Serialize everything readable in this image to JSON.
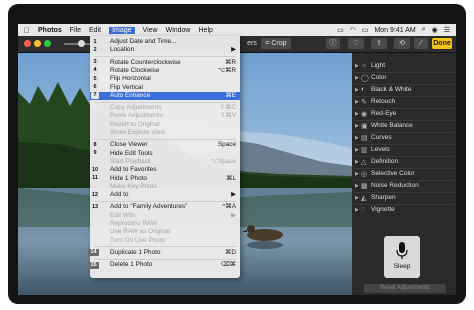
{
  "menubar": {
    "apple": "",
    "app": "Photos",
    "items": [
      "File",
      "Edit",
      "Image",
      "View",
      "Window",
      "Help"
    ],
    "clock": "Mon 9:41 AM"
  },
  "toolbar": {
    "filters_label": "ers",
    "crop_label": "Crop",
    "done_label": "Done"
  },
  "image_menu": [
    {
      "badge": "1",
      "label": "Adjust Date and Time...",
      "shortcut": "",
      "enabled": true
    },
    {
      "badge": "2",
      "label": "Location",
      "shortcut": "▶",
      "enabled": true
    },
    {
      "badge": "3",
      "label": "Rotate Counterclockwise",
      "shortcut": "⌘R",
      "enabled": true
    },
    {
      "badge": "4",
      "label": "Rotate Clockwise",
      "shortcut": "⌥⌘R",
      "enabled": true
    },
    {
      "badge": "5",
      "label": "Flip Horizontal",
      "shortcut": "",
      "enabled": true
    },
    {
      "badge": "6",
      "label": "Flip Vertical",
      "shortcut": "",
      "enabled": true
    },
    {
      "badge": "7",
      "label": "Auto Enhance",
      "shortcut": "⌘E",
      "enabled": true
    },
    {
      "badge": "",
      "label": "Copy Adjustments",
      "shortcut": "⇧⌘C",
      "enabled": false
    },
    {
      "badge": "",
      "label": "Paste Adjustments",
      "shortcut": "⇧⌘V",
      "enabled": false
    },
    {
      "badge": "",
      "label": "Revert to Original",
      "shortcut": "",
      "enabled": false
    },
    {
      "badge": "",
      "label": "Show Explore View",
      "shortcut": "",
      "enabled": false
    },
    {
      "badge": "8",
      "label": "Close Viewer",
      "shortcut": "Space",
      "enabled": true
    },
    {
      "badge": "9",
      "label": "Hide Edit Tools",
      "shortcut": "",
      "enabled": true
    },
    {
      "badge": "",
      "label": "Start Playback",
      "shortcut": "⌥Space",
      "enabled": false
    },
    {
      "badge": "10",
      "label": "Add to Favorites",
      "shortcut": "",
      "enabled": true
    },
    {
      "badge": "11",
      "label": "Hide 1 Photo",
      "shortcut": "⌘L",
      "enabled": true
    },
    {
      "badge": "",
      "label": "Make Key Photo",
      "shortcut": "",
      "enabled": false
    },
    {
      "badge": "12",
      "label": "Add to",
      "shortcut": "▶",
      "enabled": true
    },
    {
      "badge": "13",
      "label": "Add to \"Family Adventures\"",
      "shortcut": "^⌘A",
      "enabled": true
    },
    {
      "badge": "",
      "label": "Edit With",
      "shortcut": "▶",
      "enabled": false
    },
    {
      "badge": "",
      "label": "Reprocess RAW",
      "shortcut": "",
      "enabled": false
    },
    {
      "badge": "",
      "label": "Use RAW as Original",
      "shortcut": "",
      "enabled": false
    },
    {
      "badge": "",
      "label": "Turn On Live Photo",
      "shortcut": "",
      "enabled": false
    },
    {
      "badge": "14",
      "label": "Duplicate 1 Photo",
      "shortcut": "⌘D",
      "enabled": true
    },
    {
      "badge": "15",
      "label": "Delete 1 Photo",
      "shortcut": "⌫⌘",
      "enabled": true
    }
  ],
  "highlighted_item": "Auto Enhance",
  "adjust_panel": {
    "items": [
      {
        "label": "Light",
        "icon": "sun-icon"
      },
      {
        "label": "Color",
        "icon": "color-circle-icon"
      },
      {
        "label": "Black & White",
        "icon": "half-circle-icon"
      },
      {
        "label": "Retouch",
        "icon": "bandage-icon"
      },
      {
        "label": "Red-Eye",
        "icon": "eye-icon"
      },
      {
        "label": "White Balance",
        "icon": "white-balance-icon"
      },
      {
        "label": "Curves",
        "icon": "curves-icon"
      },
      {
        "label": "Levels",
        "icon": "levels-icon"
      },
      {
        "label": "Definition",
        "icon": "triangle-icon"
      },
      {
        "label": "Selective Color",
        "icon": "target-icon"
      },
      {
        "label": "Noise Reduction",
        "icon": "noise-icon"
      },
      {
        "label": "Sharpen",
        "icon": "sharpen-icon"
      },
      {
        "label": "Vignette",
        "icon": "vignette-icon"
      }
    ],
    "sleep_label": "Sleep",
    "reset_label": "Reset Adjustments"
  },
  "colors": {
    "highlight": "#3b6fd9",
    "done_button": "#f3c316",
    "panel_bg": "#2a2a2a"
  }
}
